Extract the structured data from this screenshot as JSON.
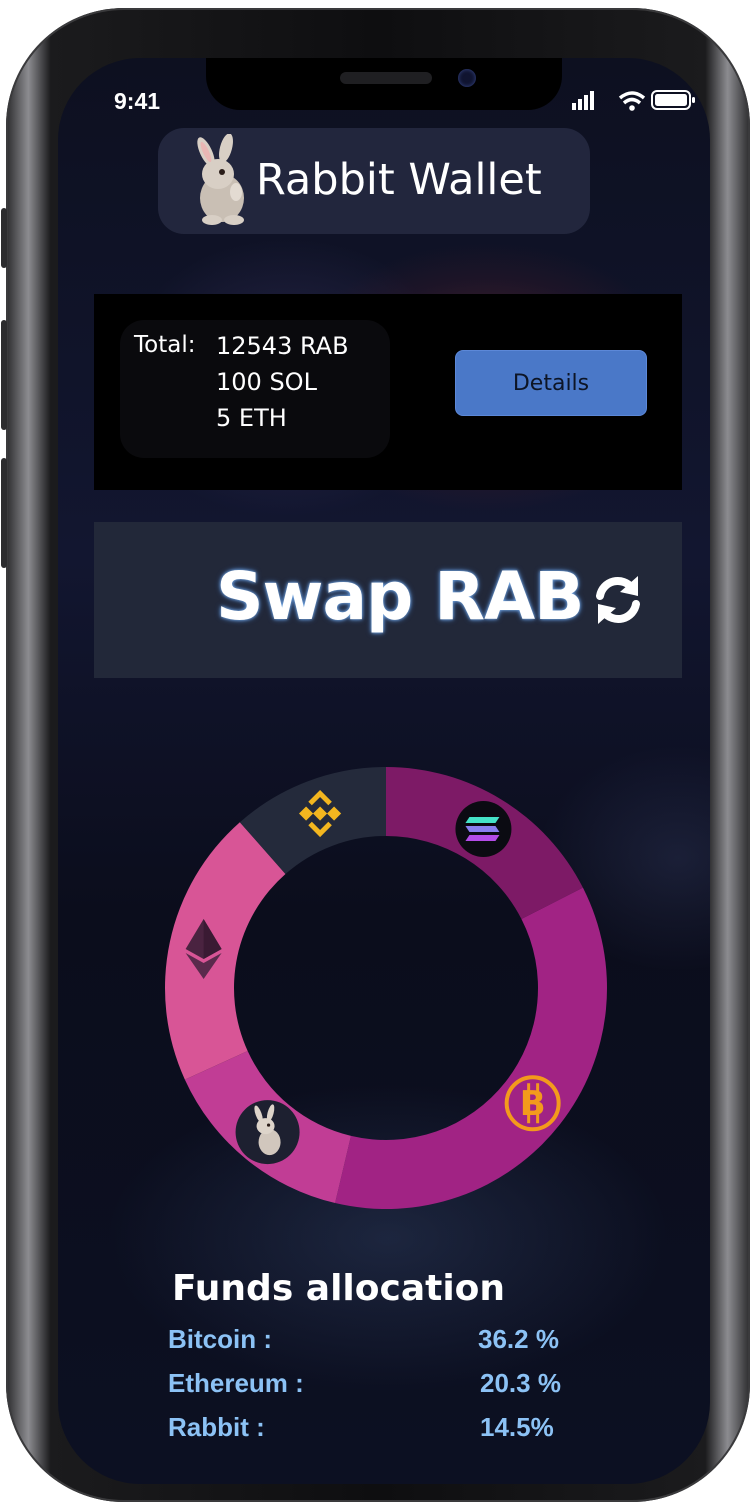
{
  "status_bar": {
    "time": "9:41",
    "icons": [
      "signal-icon",
      "wifi-icon",
      "battery-icon"
    ]
  },
  "header": {
    "app_name": "Rabbit Wallet",
    "logo_icon": "rabbit-icon"
  },
  "balance": {
    "label": "Total:",
    "items": [
      "12543 RAB",
      "100 SOL",
      "5 ETH"
    ],
    "details_button": "Details"
  },
  "swap": {
    "label": "Swap RAB",
    "icon": "refresh-icon"
  },
  "chart_data": {
    "type": "pie",
    "style": "donut",
    "categories": [
      "Solana",
      "Bitcoin",
      "Rabbit",
      "Ethereum",
      "BNB"
    ],
    "values": [
      17.5,
      36.2,
      14.5,
      20.3,
      11.5
    ],
    "colors": [
      "#7d1a66",
      "#a12384",
      "#c13d95",
      "#d85596",
      "#242a3b"
    ],
    "icons": [
      "solana-icon",
      "bitcoin-icon",
      "rabbit-icon",
      "ethereum-icon",
      "bnb-icon"
    ]
  },
  "funds": {
    "title": "Funds allocation",
    "rows": [
      {
        "name": "Bitcoin :",
        "value": "36.2 %"
      },
      {
        "name": "Ethereum :",
        "value": "20.3 %"
      },
      {
        "name": "Rabbit :",
        "value": "14.5%"
      }
    ]
  }
}
